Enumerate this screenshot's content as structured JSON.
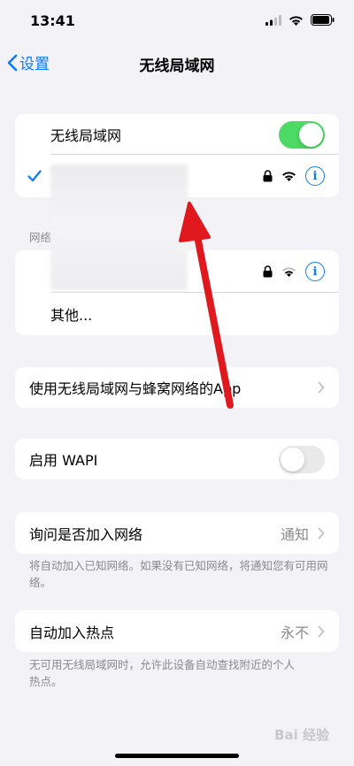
{
  "status": {
    "time": "13:41"
  },
  "nav": {
    "back_label": "设置",
    "title": "无线局域网"
  },
  "wlan": {
    "toggle_label": "无线局域网",
    "toggle_on": true,
    "connected_network": ""
  },
  "networks": {
    "header": "网络",
    "other_label": "其他..."
  },
  "apps_row": {
    "label": "使用无线局域网与蜂窝网络的App"
  },
  "wapi": {
    "label": "启用 WAPI",
    "toggle_on": false
  },
  "ask_join": {
    "label": "询问是否加入网络",
    "value": "通知",
    "footnote": "将自动加入已知网络。如果没有已知网络，将通知您有可用网络。"
  },
  "hotspot": {
    "label": "自动加入热点",
    "value": "永不",
    "footnote": "无可用无线局域网时，允许此设备自动查找附近的个人热点。"
  },
  "colors": {
    "accent": "#0a7aff",
    "toggle_on": "#4cd964",
    "arrow": "#e0191f"
  },
  "watermark": "Bai 经验"
}
